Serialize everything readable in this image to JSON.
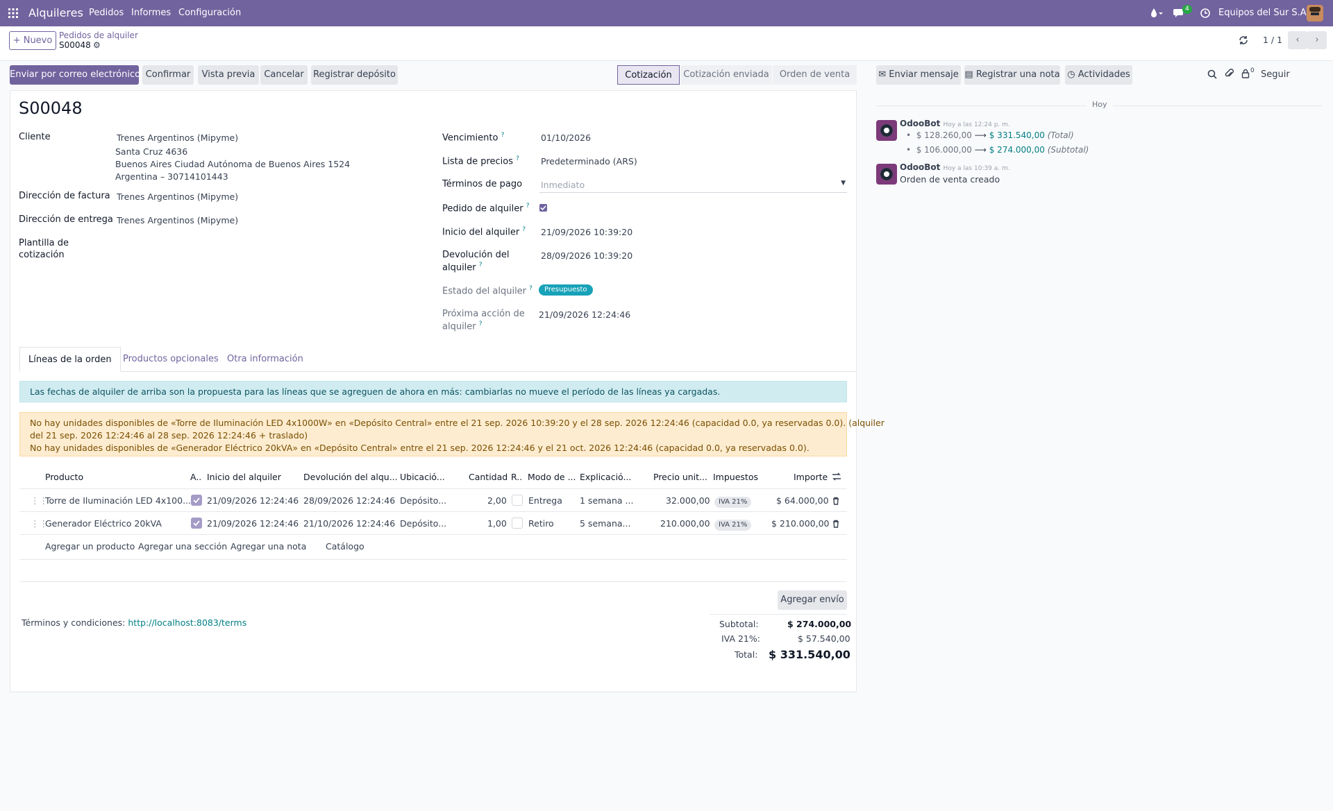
{
  "navbar": {
    "app_name": "Alquileres",
    "menus": [
      "Pedidos",
      "Informes",
      "Configuración"
    ],
    "messages_count": "4",
    "company": "Equipos del Sur S.A."
  },
  "control_panel": {
    "new_button": "Nuevo",
    "breadcrumb_parent": "Pedidos de alquiler",
    "record_name": "S00048",
    "pager": "1 / 1"
  },
  "actions": {
    "send_email": "Enviar por correo electrónico",
    "confirm": "Confirmar",
    "preview": "Vista previa",
    "cancel": "Cancelar",
    "register_deposit": "Registrar depósito"
  },
  "status_stages": [
    "Cotización",
    "Cotización enviada",
    "Orden de venta"
  ],
  "form": {
    "title": "S00048",
    "customer_label": "Cliente",
    "customer_name": "Trenes Argentinos (Mipyme)",
    "customer_address_1": "Santa Cruz 4636",
    "customer_address_2": "Buenos Aires Ciudad Autónoma de Buenos Aires 1524",
    "customer_address_3": "Argentina – 30714101443",
    "invoice_address_label": "Dirección de factura",
    "invoice_address": "Trenes Argentinos (Mipyme)",
    "delivery_address_label": "Dirección de entrega",
    "delivery_address": "Trenes Argentinos (Mipyme)",
    "quote_template_label_1": "Plantilla de",
    "quote_template_label_2": "cotización",
    "expiration_label": "Vencimiento",
    "expiration": "01/10/2026",
    "pricelist_label": "Lista de precios",
    "pricelist": "Predeterminado (ARS)",
    "payment_terms_label": "Términos de pago",
    "payment_terms_placeholder": "Inmediato",
    "rental_order_label": "Pedido de alquiler",
    "rental_start_label": "Inicio del alquiler",
    "rental_start": "21/09/2026 10:39:20",
    "rental_return_label_1": "Devolución del",
    "rental_return_label_2": "alquiler",
    "rental_return": "28/09/2026 10:39:20",
    "rental_status_label": "Estado del alquiler",
    "rental_status": "Presupuesto",
    "next_action_label_1": "Próxima acción de",
    "next_action_label_2": "alquiler",
    "next_action": "21/09/2026 12:24:46"
  },
  "tabs": [
    "Líneas de la orden",
    "Productos opcionales",
    "Otra información"
  ],
  "alerts": {
    "info": "Las fechas de alquiler de arriba son la propuesta para las líneas que se agreguen de ahora en más: cambiarlas no mueve el período de las líneas ya cargadas.",
    "warning_1": "No hay unidades disponibles de «Torre de Iluminación LED 4x1000W» en «Depósito Central» entre el 21 sep. 2026 10:39:20 y el 28 sep. 2026 12:24:46 (capacidad 0.0, ya reservadas 0.0). (alquiler",
    "warning_2": "del 21 sep. 2026 12:24:46 al 28 sep. 2026 12:24:46 + traslado)",
    "warning_3": "No hay unidades disponibles de «Generador Eléctrico 20kVA» en «Depósito Central» entre el 21 sep. 2026 12:24:46 y el 21 oct. 2026 12:24:46 (capacidad 0.0, ya reservadas 0.0)."
  },
  "table": {
    "headers": [
      "Producto",
      "A..",
      "Inicio del alquiler",
      "Devolución del alqu...",
      "Ubicació...",
      "Cantidad",
      "R..",
      "Modo de ...",
      "Explicació...",
      "Precio unit...",
      "Impuestos",
      "Importe"
    ],
    "rows": [
      {
        "product": "Torre de Iluminación LED 4x100...",
        "start": "21/09/2026 12:24:46",
        "return": "28/09/2026 12:24:46",
        "location": "Depósito...",
        "qty": "2,00",
        "mode": "Entrega",
        "explanation": "1 semana ...",
        "price": "32.000,00",
        "tax": "IVA 21%",
        "amount": "$ 64.000,00"
      },
      {
        "product": "Generador Eléctrico 20kVA",
        "start": "21/09/2026 12:24:46",
        "return": "21/10/2026 12:24:46",
        "location": "Depósito...",
        "qty": "1,00",
        "mode": "Retiro",
        "explanation": "5 semana...",
        "price": "210.000,00",
        "tax": "IVA 21%",
        "amount": "$ 210.000,00"
      }
    ],
    "add_product": "Agregar un producto",
    "add_section": "Agregar una sección",
    "add_note": "Agregar una nota",
    "catalog": "Catálogo"
  },
  "footer": {
    "add_shipping": "Agregar envío",
    "terms_label": "Términos y condiciones:",
    "terms_link": "http://localhost:8083/terms",
    "subtotal_label": "Subtotal:",
    "subtotal": "$ 274.000,00",
    "tax_label": "IVA 21%:",
    "tax": "$ 57.540,00",
    "total_label": "Total:",
    "total": "$ 331.540,00"
  },
  "chatter": {
    "send_message": "Enviar mensaje",
    "log_note": "Registrar una nota",
    "activities": "Actividades",
    "followers_count": "0",
    "follow": "Seguir",
    "day_separator": "Hoy",
    "messages": [
      {
        "author": "OdooBot",
        "time": "Hoy a las 12:24 p. m.",
        "line1_old": "$ 128.260,00",
        "line1_new": "$ 331.540,00",
        "line1_field": "(Total)",
        "line2_old": "$ 106.000,00",
        "line2_new": "$ 274.000,00",
        "line2_field": "(Subtotal)"
      },
      {
        "author": "OdooBot",
        "time": "Hoy a las 10:39 a. m.",
        "body": "Orden de venta creado"
      }
    ]
  },
  "colors": {
    "brand": "#71639e",
    "info": "#d1ecf1",
    "warning": "#fdecd0",
    "teal": "#017e84"
  }
}
